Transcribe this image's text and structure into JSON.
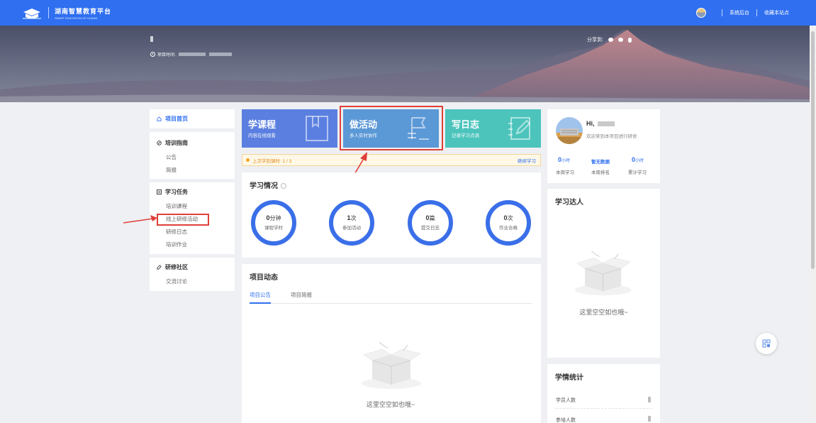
{
  "header": {
    "logo_cn": "湖南智慧教育平台",
    "logo_en": "SMART EDUCATION OF HUNAN",
    "links": [
      "系统后台",
      "收藏本站点"
    ],
    "brand_color": "#2f6ff0"
  },
  "banner": {
    "time_label": "项目时间:",
    "share_label": "分享到:"
  },
  "sidebar": {
    "home": "项目首页",
    "groups": [
      {
        "title": "培训指南",
        "items": [
          "公告",
          "简报"
        ]
      },
      {
        "title": "学习任务",
        "items": [
          "培训课程",
          "线上研修活动",
          "研修日志",
          "培训作业"
        ]
      },
      {
        "title": "研修社区",
        "items": [
          "交流讨论"
        ]
      }
    ]
  },
  "cards": [
    {
      "title": "学课程",
      "sub": "内容在线观看",
      "color": "#5b7fe0"
    },
    {
      "title": "做活动",
      "sub": "多人实时协作",
      "color": "#5b98d6"
    },
    {
      "title": "写日志",
      "sub": "记录学习点滴",
      "color": "#4cc4bc"
    }
  ],
  "progress": {
    "text": "上次学到课时: 1 / 3",
    "link": "继续学习"
  },
  "study": {
    "title": "学习情况",
    "rings": [
      {
        "value": "0",
        "unit": "分钟",
        "label": "课程学时"
      },
      {
        "value": "1",
        "unit": "次",
        "label": "参加活动"
      },
      {
        "value": "0",
        "unit": "篇",
        "label": "提交日志"
      },
      {
        "value": "0",
        "unit": "次",
        "label": "作业合格"
      }
    ]
  },
  "news": {
    "title": "项目动态",
    "tabs": [
      "项目公告",
      "项目简报"
    ],
    "empty": "这里空空如也哦~"
  },
  "user": {
    "greeting": "Hi,",
    "welcome": "欢迎来到本项目进行研修",
    "stats": [
      {
        "num": "0",
        "unit": "小时",
        "label": "本周学习"
      },
      {
        "num": "暂无数据",
        "unit": "",
        "label": "本周排名"
      },
      {
        "num": "0",
        "unit": "小时",
        "label": "累计学习"
      }
    ]
  },
  "experts": {
    "title": "学习达人",
    "empty": "这里空空如也哦~"
  },
  "stats_panel": {
    "title": "学情统计",
    "rows": [
      "学员人数",
      "参培人数"
    ]
  }
}
